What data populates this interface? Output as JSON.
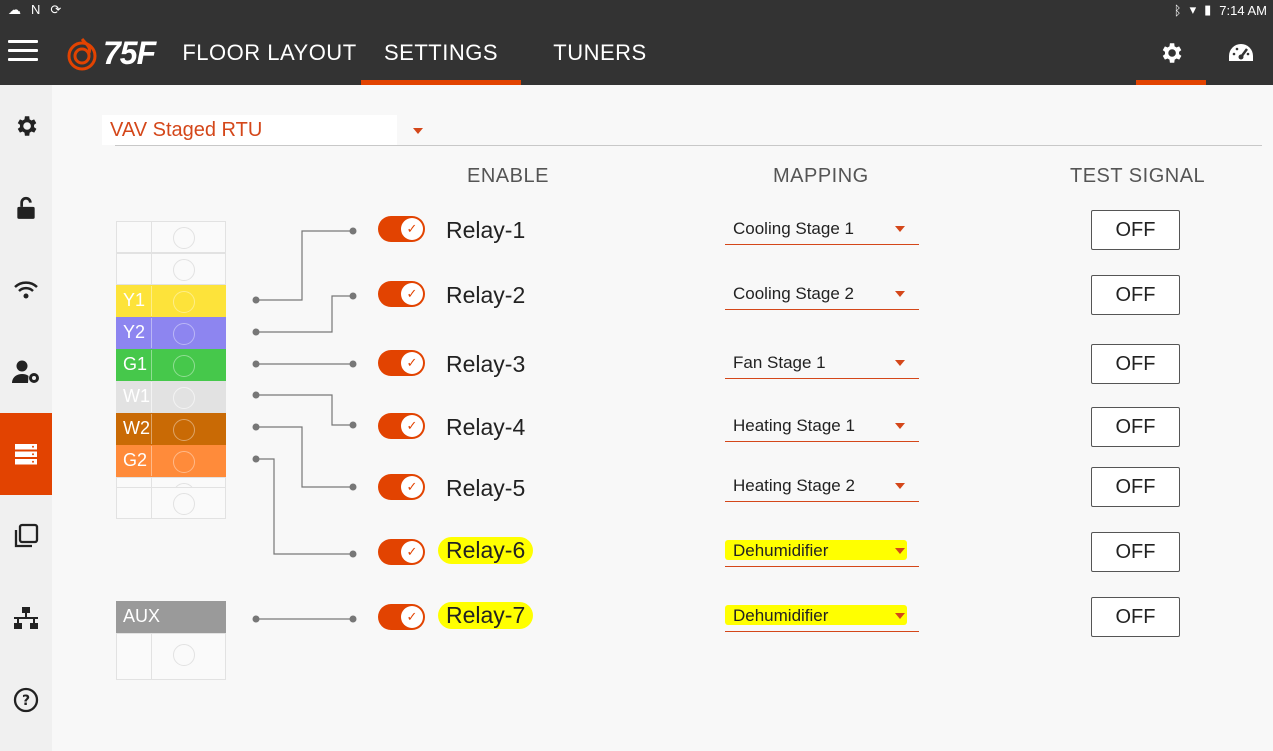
{
  "status_bar": {
    "time": "7:14 AM"
  },
  "header": {
    "logo_text": "75F",
    "tabs": [
      {
        "label": "FLOOR LAYOUT",
        "active": false
      },
      {
        "label": "SETTINGS",
        "active": true
      },
      {
        "label": "TUNERS",
        "active": false
      }
    ],
    "icons": [
      "settings-gear-icon",
      "dashboard-gauge-icon"
    ],
    "active_icon": "settings-gear-icon",
    "accent_color": "#e24301"
  },
  "sidebar": {
    "items": [
      {
        "icon": "gear-icon",
        "active": false
      },
      {
        "icon": "unlock-icon",
        "active": false
      },
      {
        "icon": "wifi-icon",
        "active": false
      },
      {
        "icon": "user-settings-icon",
        "active": false
      },
      {
        "icon": "server-icon",
        "active": true
      },
      {
        "icon": "copy-icon",
        "active": false
      },
      {
        "icon": "network-icon",
        "active": false
      },
      {
        "icon": "help-icon",
        "active": false
      }
    ]
  },
  "main": {
    "profile_select": {
      "value": "VAV Staged RTU"
    },
    "columns": {
      "enable": "ENABLE",
      "mapping": "MAPPING",
      "test_signal": "TEST SIGNAL"
    },
    "terminals": [
      {
        "label": "",
        "color": ""
      },
      {
        "label": "",
        "color": ""
      },
      {
        "label": "Y1",
        "color": "#fde33a"
      },
      {
        "label": "Y2",
        "color": "#8d85f0"
      },
      {
        "label": "G1",
        "color": "#46c84b"
      },
      {
        "label": "W1",
        "color": "#e2e2e2"
      },
      {
        "label": "W2",
        "color": "#c96a05"
      },
      {
        "label": "G2",
        "color": "#ff8b3a"
      },
      {
        "label": "",
        "color": ""
      },
      {
        "label": "",
        "color": ""
      }
    ],
    "aux_terminal": {
      "label": "AUX",
      "color": "#9a9a9a"
    },
    "relays": [
      {
        "name": "Relay-1",
        "enabled": true,
        "mapping": "Cooling Stage 1",
        "test": "OFF",
        "highlighted": false
      },
      {
        "name": "Relay-2",
        "enabled": true,
        "mapping": "Cooling Stage 2",
        "test": "OFF",
        "highlighted": false
      },
      {
        "name": "Relay-3",
        "enabled": true,
        "mapping": "Fan Stage 1",
        "test": "OFF",
        "highlighted": false
      },
      {
        "name": "Relay-4",
        "enabled": true,
        "mapping": "Heating Stage 1",
        "test": "OFF",
        "highlighted": false
      },
      {
        "name": "Relay-5",
        "enabled": true,
        "mapping": "Heating Stage 2",
        "test": "OFF",
        "highlighted": false
      },
      {
        "name": "Relay-6",
        "enabled": true,
        "mapping": "Dehumidifier",
        "test": "OFF",
        "highlighted": true
      },
      {
        "name": "Relay-7",
        "enabled": true,
        "mapping": "Dehumidifier",
        "test": "OFF",
        "highlighted": true
      }
    ]
  }
}
